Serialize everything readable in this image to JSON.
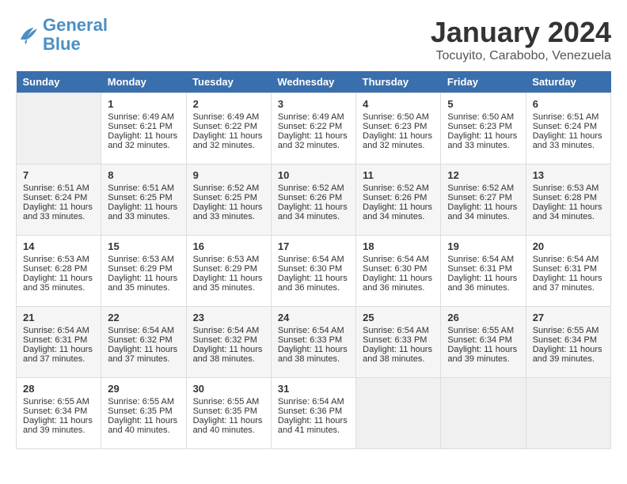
{
  "header": {
    "logo_general": "General",
    "logo_blue": "Blue",
    "month_year": "January 2024",
    "location": "Tocuyito, Carabobo, Venezuela"
  },
  "days_of_week": [
    "Sunday",
    "Monday",
    "Tuesday",
    "Wednesday",
    "Thursday",
    "Friday",
    "Saturday"
  ],
  "weeks": [
    [
      {
        "day": "",
        "sunrise": "",
        "sunset": "",
        "daylight": ""
      },
      {
        "day": "1",
        "sunrise": "Sunrise: 6:49 AM",
        "sunset": "Sunset: 6:21 PM",
        "daylight": "Daylight: 11 hours and 32 minutes."
      },
      {
        "day": "2",
        "sunrise": "Sunrise: 6:49 AM",
        "sunset": "Sunset: 6:22 PM",
        "daylight": "Daylight: 11 hours and 32 minutes."
      },
      {
        "day": "3",
        "sunrise": "Sunrise: 6:49 AM",
        "sunset": "Sunset: 6:22 PM",
        "daylight": "Daylight: 11 hours and 32 minutes."
      },
      {
        "day": "4",
        "sunrise": "Sunrise: 6:50 AM",
        "sunset": "Sunset: 6:23 PM",
        "daylight": "Daylight: 11 hours and 32 minutes."
      },
      {
        "day": "5",
        "sunrise": "Sunrise: 6:50 AM",
        "sunset": "Sunset: 6:23 PM",
        "daylight": "Daylight: 11 hours and 33 minutes."
      },
      {
        "day": "6",
        "sunrise": "Sunrise: 6:51 AM",
        "sunset": "Sunset: 6:24 PM",
        "daylight": "Daylight: 11 hours and 33 minutes."
      }
    ],
    [
      {
        "day": "7",
        "sunrise": "Sunrise: 6:51 AM",
        "sunset": "Sunset: 6:24 PM",
        "daylight": "Daylight: 11 hours and 33 minutes."
      },
      {
        "day": "8",
        "sunrise": "Sunrise: 6:51 AM",
        "sunset": "Sunset: 6:25 PM",
        "daylight": "Daylight: 11 hours and 33 minutes."
      },
      {
        "day": "9",
        "sunrise": "Sunrise: 6:52 AM",
        "sunset": "Sunset: 6:25 PM",
        "daylight": "Daylight: 11 hours and 33 minutes."
      },
      {
        "day": "10",
        "sunrise": "Sunrise: 6:52 AM",
        "sunset": "Sunset: 6:26 PM",
        "daylight": "Daylight: 11 hours and 34 minutes."
      },
      {
        "day": "11",
        "sunrise": "Sunrise: 6:52 AM",
        "sunset": "Sunset: 6:26 PM",
        "daylight": "Daylight: 11 hours and 34 minutes."
      },
      {
        "day": "12",
        "sunrise": "Sunrise: 6:52 AM",
        "sunset": "Sunset: 6:27 PM",
        "daylight": "Daylight: 11 hours and 34 minutes."
      },
      {
        "day": "13",
        "sunrise": "Sunrise: 6:53 AM",
        "sunset": "Sunset: 6:28 PM",
        "daylight": "Daylight: 11 hours and 34 minutes."
      }
    ],
    [
      {
        "day": "14",
        "sunrise": "Sunrise: 6:53 AM",
        "sunset": "Sunset: 6:28 PM",
        "daylight": "Daylight: 11 hours and 35 minutes."
      },
      {
        "day": "15",
        "sunrise": "Sunrise: 6:53 AM",
        "sunset": "Sunset: 6:29 PM",
        "daylight": "Daylight: 11 hours and 35 minutes."
      },
      {
        "day": "16",
        "sunrise": "Sunrise: 6:53 AM",
        "sunset": "Sunset: 6:29 PM",
        "daylight": "Daylight: 11 hours and 35 minutes."
      },
      {
        "day": "17",
        "sunrise": "Sunrise: 6:54 AM",
        "sunset": "Sunset: 6:30 PM",
        "daylight": "Daylight: 11 hours and 36 minutes."
      },
      {
        "day": "18",
        "sunrise": "Sunrise: 6:54 AM",
        "sunset": "Sunset: 6:30 PM",
        "daylight": "Daylight: 11 hours and 36 minutes."
      },
      {
        "day": "19",
        "sunrise": "Sunrise: 6:54 AM",
        "sunset": "Sunset: 6:31 PM",
        "daylight": "Daylight: 11 hours and 36 minutes."
      },
      {
        "day": "20",
        "sunrise": "Sunrise: 6:54 AM",
        "sunset": "Sunset: 6:31 PM",
        "daylight": "Daylight: 11 hours and 37 minutes."
      }
    ],
    [
      {
        "day": "21",
        "sunrise": "Sunrise: 6:54 AM",
        "sunset": "Sunset: 6:31 PM",
        "daylight": "Daylight: 11 hours and 37 minutes."
      },
      {
        "day": "22",
        "sunrise": "Sunrise: 6:54 AM",
        "sunset": "Sunset: 6:32 PM",
        "daylight": "Daylight: 11 hours and 37 minutes."
      },
      {
        "day": "23",
        "sunrise": "Sunrise: 6:54 AM",
        "sunset": "Sunset: 6:32 PM",
        "daylight": "Daylight: 11 hours and 38 minutes."
      },
      {
        "day": "24",
        "sunrise": "Sunrise: 6:54 AM",
        "sunset": "Sunset: 6:33 PM",
        "daylight": "Daylight: 11 hours and 38 minutes."
      },
      {
        "day": "25",
        "sunrise": "Sunrise: 6:54 AM",
        "sunset": "Sunset: 6:33 PM",
        "daylight": "Daylight: 11 hours and 38 minutes."
      },
      {
        "day": "26",
        "sunrise": "Sunrise: 6:55 AM",
        "sunset": "Sunset: 6:34 PM",
        "daylight": "Daylight: 11 hours and 39 minutes."
      },
      {
        "day": "27",
        "sunrise": "Sunrise: 6:55 AM",
        "sunset": "Sunset: 6:34 PM",
        "daylight": "Daylight: 11 hours and 39 minutes."
      }
    ],
    [
      {
        "day": "28",
        "sunrise": "Sunrise: 6:55 AM",
        "sunset": "Sunset: 6:34 PM",
        "daylight": "Daylight: 11 hours and 39 minutes."
      },
      {
        "day": "29",
        "sunrise": "Sunrise: 6:55 AM",
        "sunset": "Sunset: 6:35 PM",
        "daylight": "Daylight: 11 hours and 40 minutes."
      },
      {
        "day": "30",
        "sunrise": "Sunrise: 6:55 AM",
        "sunset": "Sunset: 6:35 PM",
        "daylight": "Daylight: 11 hours and 40 minutes."
      },
      {
        "day": "31",
        "sunrise": "Sunrise: 6:54 AM",
        "sunset": "Sunset: 6:36 PM",
        "daylight": "Daylight: 11 hours and 41 minutes."
      },
      {
        "day": "",
        "sunrise": "",
        "sunset": "",
        "daylight": ""
      },
      {
        "day": "",
        "sunrise": "",
        "sunset": "",
        "daylight": ""
      },
      {
        "day": "",
        "sunrise": "",
        "sunset": "",
        "daylight": ""
      }
    ]
  ]
}
